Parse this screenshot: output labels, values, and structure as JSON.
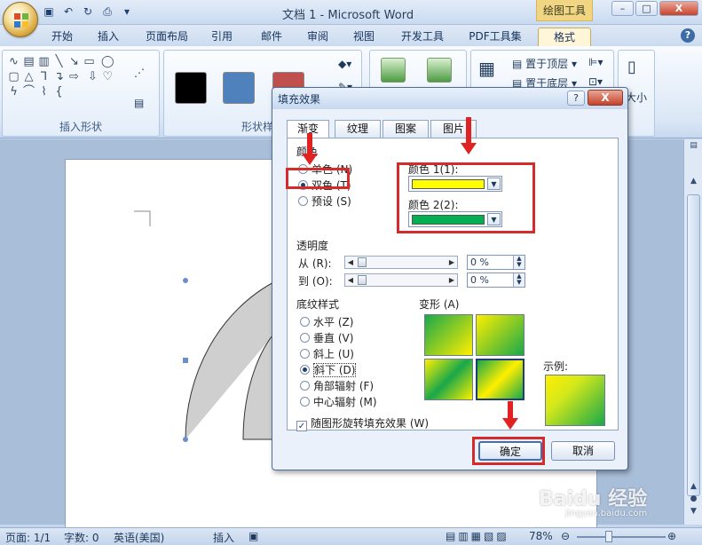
{
  "window": {
    "title": "文档 1 - Microsoft Word",
    "context_tab_title": "绘图工具",
    "minimize": "–",
    "maximize": "□",
    "close": "X"
  },
  "ribbon_tabs": [
    "开始",
    "插入",
    "页面布局",
    "引用",
    "邮件",
    "审阅",
    "视图",
    "开发工具",
    "PDF工具集",
    "格式"
  ],
  "active_tab": "格式",
  "ribbon": {
    "insert_shapes_group": "插入形状",
    "shape_styles_group": "形状样式",
    "bring_to_front": "置于顶层",
    "send_to_back": "置于底层",
    "size": "大小",
    "swatch_colors": [
      "#000000",
      "#4f81bd",
      "#c0504d"
    ]
  },
  "dialog": {
    "title": "填充效果",
    "help": "?",
    "close": "X",
    "tabs": [
      "渐变",
      "纹理",
      "图案",
      "图片"
    ],
    "active_tab": "渐变",
    "colors_section": "颜色",
    "color_options": [
      {
        "label": "单色 (N)",
        "selected": false
      },
      {
        "label": "双色 (T)",
        "selected": true
      },
      {
        "label": "预设 (S)",
        "selected": false
      }
    ],
    "color1_label": "颜色 1(1):",
    "color1_value": "#ffff00",
    "color2_label": "颜色 2(2):",
    "color2_value": "#00b050",
    "transparency_section": "透明度",
    "from_label": "从 (R):",
    "to_label": "到 (O):",
    "from_value": "0 %",
    "to_value": "0 %",
    "shading_section": "底纹样式",
    "shading_options": [
      {
        "label": "水平 (Z)",
        "selected": false
      },
      {
        "label": "垂直 (V)",
        "selected": false
      },
      {
        "label": "斜上 (U)",
        "selected": false
      },
      {
        "label": "斜下 (D)",
        "selected": true
      },
      {
        "label": "角部辐射 (F)",
        "selected": false
      },
      {
        "label": "中心辐射 (M)",
        "selected": false
      }
    ],
    "variants_label": "变形 (A)",
    "sample_label": "示例:",
    "rotate_checkbox": "随图形旋转填充效果 (W)",
    "rotate_checked": true,
    "ok": "确定",
    "cancel": "取消"
  },
  "statusbar": {
    "page": "页面: 1/1",
    "words": "字数: 0",
    "language": "英语(美国)",
    "mode": "插入",
    "zoom": "78%"
  },
  "watermark": {
    "brand": "Baidu 经验",
    "url": "jingyan.baidu.com"
  }
}
